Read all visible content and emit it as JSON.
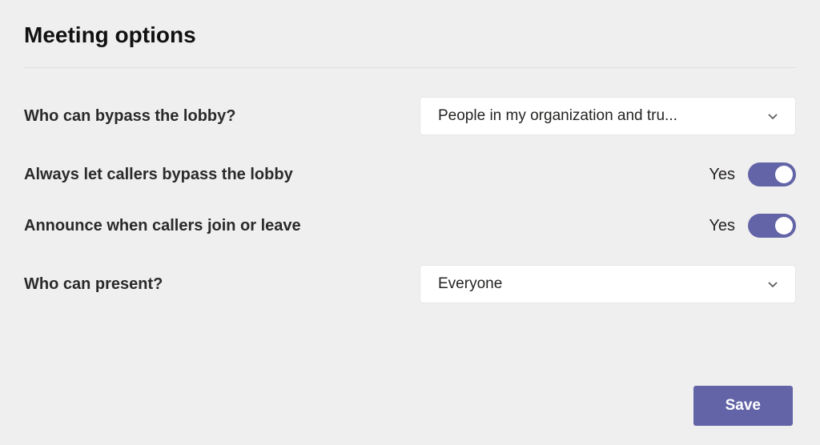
{
  "title": "Meeting options",
  "options": {
    "bypassLobby": {
      "label": "Who can bypass the lobby?",
      "value": "People in my organization and tru..."
    },
    "alwaysLetCallersBypass": {
      "label": "Always let callers bypass the lobby",
      "value": "Yes"
    },
    "announceCallers": {
      "label": "Announce when callers join or leave",
      "value": "Yes"
    },
    "whoCanPresent": {
      "label": "Who can present?",
      "value": "Everyone"
    }
  },
  "buttons": {
    "save": "Save"
  },
  "colors": {
    "accent": "#6264a7",
    "background": "#f0efef"
  }
}
